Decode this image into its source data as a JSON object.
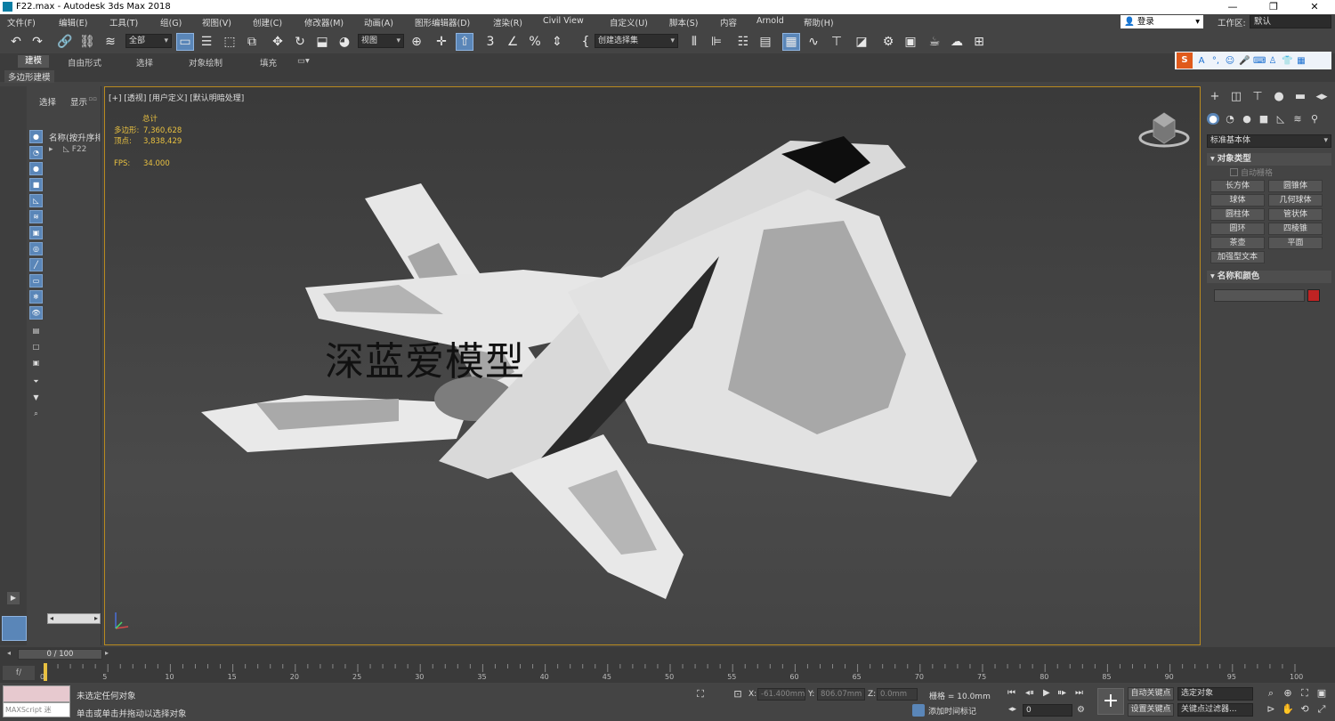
{
  "window": {
    "title": "F22.max - Autodesk 3ds Max 2018",
    "minimize": "—",
    "restore": "❐",
    "close": "✕"
  },
  "menu": {
    "items": [
      "文件(F)",
      "编辑(E)",
      "工具(T)",
      "组(G)",
      "视图(V)",
      "创建(C)",
      "修改器(M)",
      "动画(A)",
      "图形编辑器(D)",
      "渲染(R)",
      "Civil View",
      "自定义(U)",
      "脚本(S)",
      "内容",
      "Arnold",
      "帮助(H)"
    ],
    "login": "登录",
    "workspace_label": "工作区:",
    "workspace_value": "默认"
  },
  "toolbar": {
    "selection_filter": "全部",
    "ref_coord": "视图",
    "named_selection": "创建选择集"
  },
  "ribbon": {
    "tabs": [
      "建模",
      "自由形式",
      "选择",
      "对象绘制",
      "填充"
    ],
    "active_tab": "建模",
    "sub_label": "多边形建模"
  },
  "scene_explorer": {
    "tab_select": "选择",
    "tab_display": "显示",
    "column_header": "名称(按升序排",
    "tree_item": "F22"
  },
  "viewport": {
    "label": "[+] [透视] [用户定义] [默认明暗处理]",
    "stats_title": "总计",
    "polygons_label": "多边形:",
    "polygons_value": "7,360,628",
    "vertices_label": "顶点:",
    "vertices_value": "3,838,429",
    "fps_label": "FPS:",
    "fps_value": "34.000",
    "watermark": "深蓝爱模型"
  },
  "command_panel": {
    "category_dropdown": "标准基本体",
    "rollout_object_type": "对象类型",
    "auto_grid": "自动栅格",
    "primitives": [
      "长方体",
      "圆锥体",
      "球体",
      "几何球体",
      "圆柱体",
      "管状体",
      "圆环",
      "四棱锥",
      "茶壶",
      "平面",
      "加强型文本"
    ],
    "rollout_name_color": "名称和颜色",
    "object_color": "#c02323"
  },
  "timeline": {
    "frame_display": "0 / 100",
    "ticks": [
      "0",
      "5",
      "10",
      "15",
      "20",
      "25",
      "30",
      "35",
      "40",
      "45",
      "50",
      "55",
      "60",
      "65",
      "70",
      "75",
      "80",
      "85",
      "90",
      "95",
      "100"
    ]
  },
  "status": {
    "maxscript_label": "MAXScript 迷",
    "message1": "未选定任何对象",
    "message2": "单击或单击并拖动以选择对象",
    "x_label": "X:",
    "x_value": "-61.400mm",
    "y_label": "Y:",
    "y_value": "806.07mm",
    "z_label": "Z:",
    "z_value": "0.0mm",
    "grid": "栅格 = 10.0mm",
    "add_time_tag": "添加时间标记",
    "frame_value": "0",
    "auto_key": "自动关键点",
    "set_key": "设置关键点",
    "key_mode_dropdown": "选定对象",
    "key_filters": "关键点过滤器..."
  },
  "colors": {
    "accent": "#5a86b8",
    "viewport_border": "#b98a1f",
    "stats_text": "#e8c040"
  }
}
